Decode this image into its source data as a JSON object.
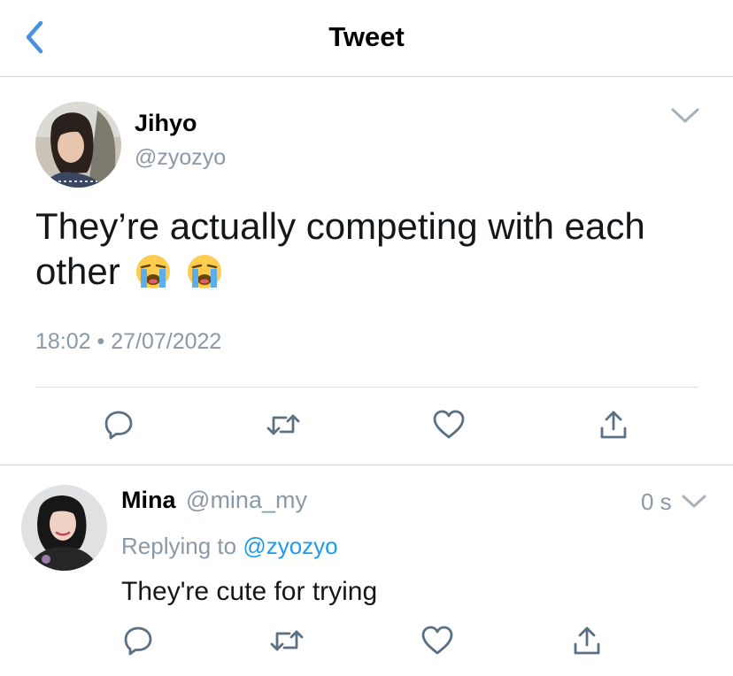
{
  "nav": {
    "title": "Tweet",
    "back_icon": "chevron-left-icon"
  },
  "main_tweet": {
    "name": "Jihyo",
    "handle": "@zyozyo",
    "text": "They’re actually competing with each other",
    "emoji": [
      "loudly-crying-face",
      "loudly-crying-face"
    ],
    "timestamp": "18:02 • 27/07/2022",
    "actions": [
      "reply-icon",
      "retweet-icon",
      "like-icon",
      "share-icon"
    ]
  },
  "reply": {
    "name": "Mina",
    "handle": "@mina_my",
    "time": "0 s",
    "replying_prefix": "Replying to",
    "replying_to": "@zyozyo",
    "text": "They're cute for trying",
    "actions": [
      "reply-icon",
      "retweet-icon",
      "like-icon",
      "share-icon"
    ]
  },
  "colors": {
    "accent": "#4a90e2",
    "link": "#1d9bf0",
    "secondary_text": "#8b98a5",
    "icon": "#5b7083",
    "divider": "#cfd4d8"
  }
}
